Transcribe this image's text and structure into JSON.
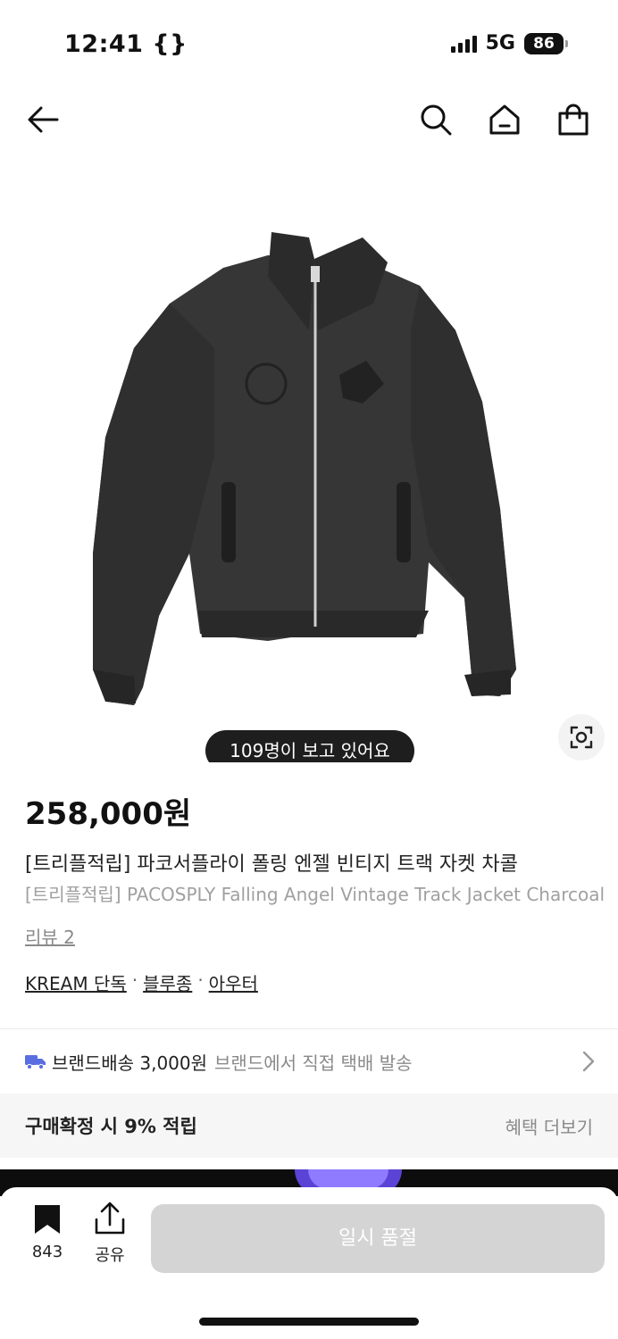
{
  "status": {
    "time": "12:41 {}",
    "network": "5G",
    "battery": "86"
  },
  "nav": {
    "icons": [
      "back-arrow-icon",
      "search-icon",
      "home-icon",
      "shopping-bag-icon"
    ]
  },
  "product": {
    "image": "black-track-jacket-photo",
    "viewers": "109명이 보고 있어요",
    "price": "258,000원",
    "title_ko": "[트리플적립] 파코서플라이 폴링 엔젤 빈티지 트랙 자켓 차콜",
    "title_en": "[트리플적립] PACOSPLY Falling Angel Vintage Track Jacket Charcoal",
    "review": "리뷰 2",
    "categories": [
      "KREAM 단독",
      "블루종",
      "아우터"
    ],
    "category_sep": "·"
  },
  "delivery": {
    "label": "브랜드배송 3,000원",
    "desc": "브랜드에서 직접 택배 발송",
    "icon_color": "#5b6ee1"
  },
  "benefit": {
    "label": "구매확정 시 9% 적립",
    "more": "혜택 더보기"
  },
  "bottom": {
    "bookmark_count": "843",
    "share_label": "공유",
    "action_label": "일시 품절"
  }
}
